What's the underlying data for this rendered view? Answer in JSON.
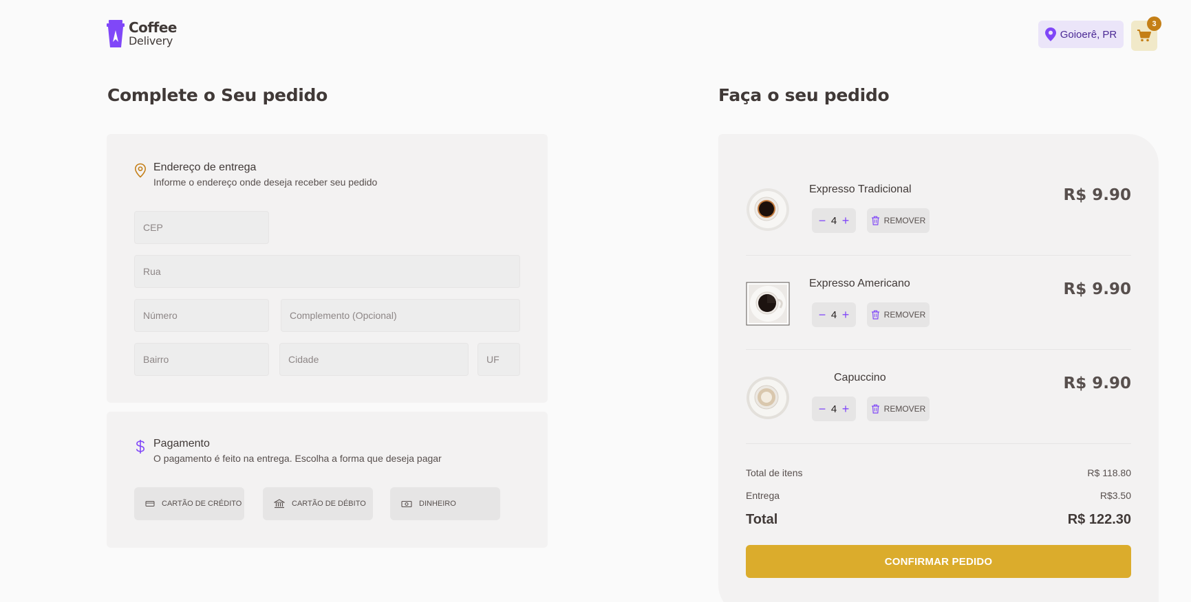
{
  "header": {
    "logo_line1": "Coffee",
    "logo_line2": "Delivery",
    "location": "Goioerê, PR",
    "cart_count": "3"
  },
  "checkout": {
    "title": "Complete o Seu pedido",
    "address": {
      "title": "Endereço de entrega",
      "subtitle": "Informe o endereço onde deseja receber seu pedido",
      "fields": {
        "cep": "CEP",
        "rua": "Rua",
        "numero": "Número",
        "complemento": "Complemento (Opcional)",
        "bairro": "Bairro",
        "cidade": "Cidade",
        "uf": "UF"
      }
    },
    "payment": {
      "title": "Pagamento",
      "subtitle": "O pagamento é feito na entrega. Escolha a forma que deseja pagar",
      "options": [
        "CARTÃO DE CRÉDITO",
        "CARTÃO DE DÉBITO",
        "DINHEIRO"
      ]
    }
  },
  "order": {
    "title": "Faça o seu pedido",
    "items": [
      {
        "name": "Expresso Tradicional",
        "quantity": "4",
        "remove_label": "REMOVER",
        "price": "R$ 9.90"
      },
      {
        "name": "Expresso Americano",
        "quantity": "4",
        "remove_label": "REMOVER",
        "price": "R$ 9.90"
      },
      {
        "name": "Capuccino",
        "quantity": "4",
        "remove_label": "REMOVER",
        "price": "R$ 9.90"
      }
    ],
    "totals": {
      "items_label": "Total de itens",
      "items_value": "R$ 118.80",
      "delivery_label": "Entrega",
      "delivery_value": "R$3.50",
      "total_label": "Total",
      "total_value": "R$ 122.30"
    },
    "confirm_label": "CONFIRMAR PEDIDO"
  },
  "colors": {
    "purple": "#8047f8",
    "purple_dark": "#4b2995",
    "yellow": "#dbac2c",
    "yellow_dark": "#c47f17",
    "background": "#fafafa",
    "card": "#f3f2f2"
  }
}
